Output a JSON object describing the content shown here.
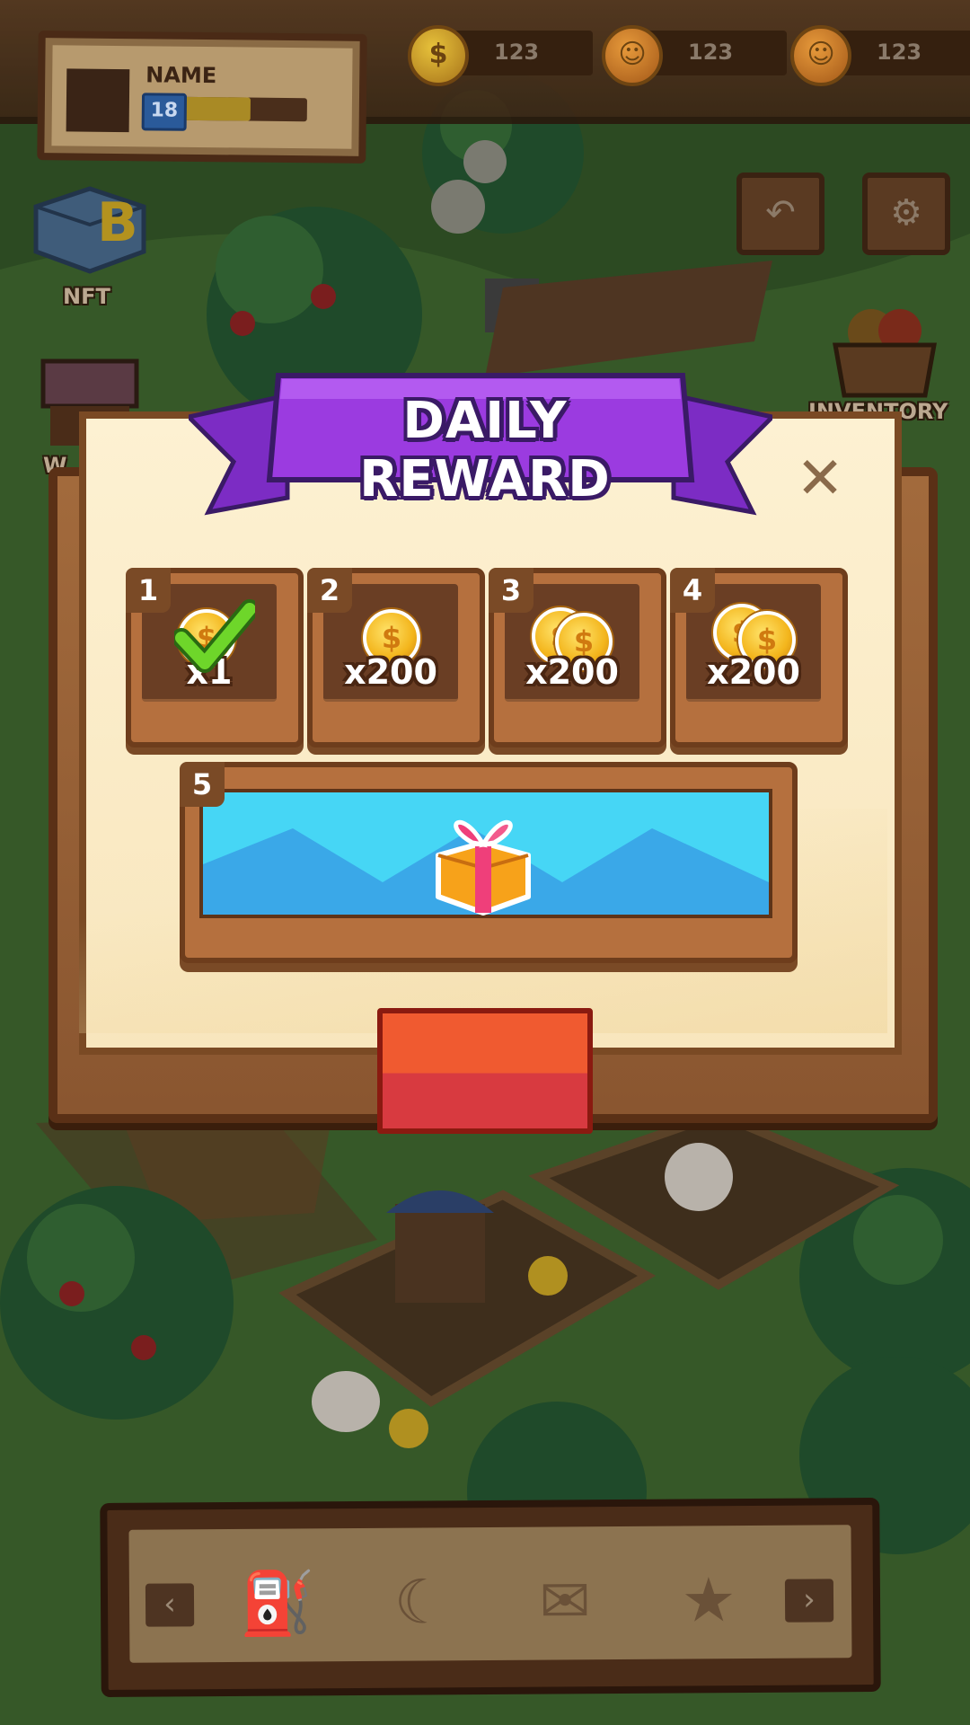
{
  "profile": {
    "name": "NAME",
    "level": "18",
    "xp_fraction": 0.65
  },
  "currencies": [
    {
      "icon": "gold-coin-icon",
      "value": "123"
    },
    {
      "icon": "orange-coin-icon",
      "value": "123"
    },
    {
      "icon": "orange-coin-icon",
      "value": "123"
    }
  ],
  "side_menu": {
    "nft_label": "NFT",
    "inventory_label": "INVENTORY",
    "left_partial_label": "W"
  },
  "dialog": {
    "title": "DAILY REWARD",
    "days": [
      {
        "day": "1",
        "amount": "x1",
        "claimed": true
      },
      {
        "day": "2",
        "amount": "x200",
        "claimed": false
      },
      {
        "day": "3",
        "amount": "x200",
        "claimed": false
      },
      {
        "day": "4",
        "amount": "x200",
        "claimed": false
      }
    ],
    "big_day": {
      "day": "5",
      "reward": "gift-box"
    },
    "claim_label": ""
  },
  "tools": [
    {
      "icon": "watering-can-icon"
    },
    {
      "icon": "sickle-icon"
    },
    {
      "icon": "seed-bag-icon"
    },
    {
      "icon": "fertilizer-bag-icon"
    }
  ],
  "colors": {
    "banner": "#9b3be0",
    "claim_button": "#e8483a",
    "coin": "#f3b51c"
  }
}
